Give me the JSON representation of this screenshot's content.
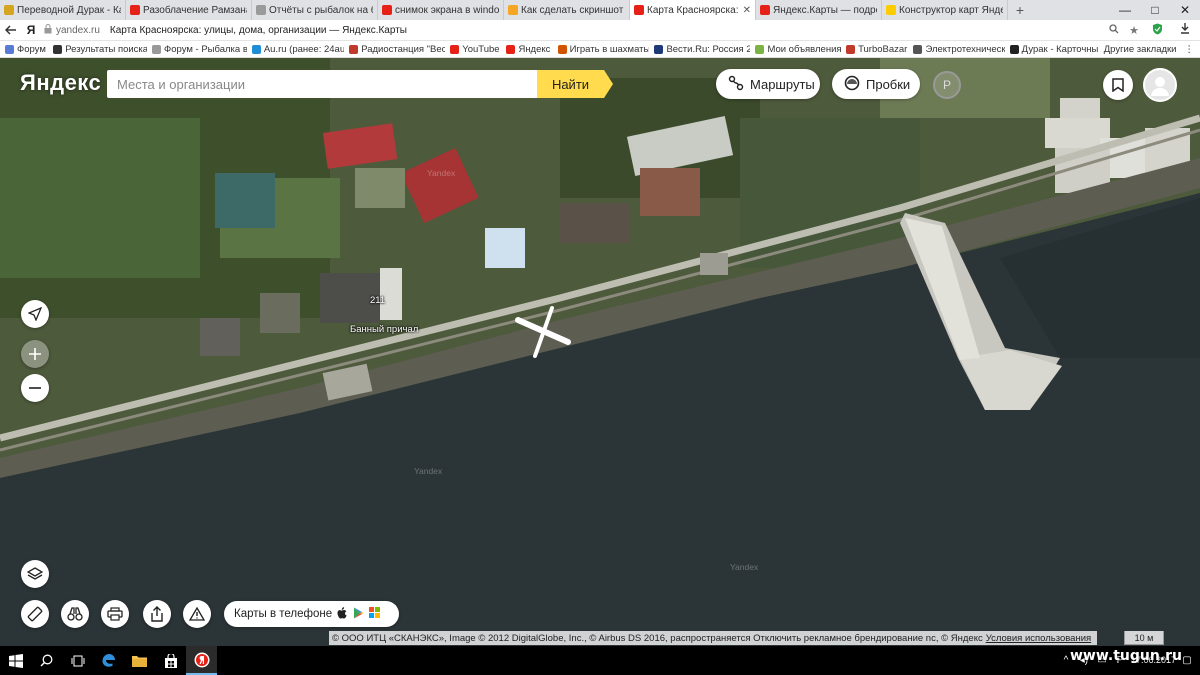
{
  "browser": {
    "tabs": [
      {
        "title": "Переводной Дурак - Карто",
        "favicon_color": "#d6a520",
        "active": false
      },
      {
        "title": "Разоблачение Рамзана Кад",
        "favicon_color": "#e62117",
        "active": false
      },
      {
        "title": "Отчёты с рыбалок на балд",
        "favicon_color": "#9a9a9a",
        "active": false
      },
      {
        "title": "снимок экрана в windows 1",
        "favicon_color": "#e62117",
        "active": false
      },
      {
        "title": "Как сделать скриншот в Wi",
        "favicon_color": "#f5a623",
        "active": false
      },
      {
        "title": "Карта Красноярска: улиц",
        "favicon_color": "#e62117",
        "active": true
      },
      {
        "title": "Яндекс.Карты — подробна",
        "favicon_color": "#e62117",
        "active": false
      },
      {
        "title": "Конструктор карт Яндекса",
        "favicon_color": "#ffcc00",
        "active": false
      }
    ],
    "new_tab": "+",
    "window_controls": [
      "—",
      "□",
      "✕"
    ],
    "address": {
      "logo": "Я",
      "domain": "yandex.ru",
      "title": "Карта Красноярска: улицы, дома, организации — Яндекс.Карты"
    },
    "bookmarks": [
      {
        "label": "Форум",
        "color": "#5a7bd5"
      },
      {
        "label": "Результаты поиска",
        "color": "#333333"
      },
      {
        "label": "Форум - Рыбалка в",
        "color": "#999999"
      },
      {
        "label": "Au.ru (ранее: 24au",
        "color": "#1f8dd6"
      },
      {
        "label": "Радиостанция \"Вес",
        "color": "#c0392b"
      },
      {
        "label": "YouTube",
        "color": "#e62117"
      },
      {
        "label": "Яндекс",
        "color": "#e62117"
      },
      {
        "label": "Играть в шахматы",
        "color": "#d35400"
      },
      {
        "label": "Вести.Ru: Россия 2",
        "color": "#1e3a78"
      },
      {
        "label": "Мои объявления",
        "color": "#7cb342"
      },
      {
        "label": "TurboBazar",
        "color": "#c0392b"
      },
      {
        "label": "Электротехническ",
        "color": "#555555"
      },
      {
        "label": "Дурак - Карточны",
        "color": "#222222"
      }
    ],
    "other_bookmarks": "Другие закладки"
  },
  "map": {
    "logo": "Яндекс",
    "search": {
      "placeholder": "Места и организации",
      "value": "",
      "button": "Найти"
    },
    "routes_label": "Маршруты",
    "traffic_label": "Пробки",
    "parking_label": "P",
    "place_labels": {
      "house_number": "211",
      "pier": "Банный причал"
    },
    "watermark": "Yandex",
    "apps_label": "Карты в телефоне",
    "copyright": "© ООО ИТЦ «СКАНЭКС», Image © 2012 DigitalGlobe, Inc., © Airbus DS 2016, распространяется Отключить рекламное брендирование nc, © Яндекс",
    "terms": "Условия использования",
    "scale": "10 м"
  },
  "taskbar": {
    "clock_time": "",
    "clock_date": "17.06.2017",
    "site_watermark": "www.tugun.ru",
    "accent_color": "#76b9ed"
  },
  "icons": [
    "back-arrow-icon",
    "lock-icon",
    "search-icon",
    "star-icon",
    "shield-icon",
    "download-icon",
    "menu-icon",
    "routes-icon",
    "traffic-icon",
    "parking-icon",
    "bookmark-icon",
    "user-icon",
    "locate-arrow-icon",
    "plus-icon",
    "minus-icon",
    "layers-icon",
    "ruler-icon",
    "binoculars-icon",
    "printer-icon",
    "share-icon",
    "warning-icon",
    "apple-icon",
    "play-store-icon",
    "windows-icon",
    "windows-start-icon",
    "search-taskbar-icon",
    "task-view-icon",
    "edge-icon",
    "explorer-icon",
    "store-icon",
    "yandex-browser-icon"
  ]
}
